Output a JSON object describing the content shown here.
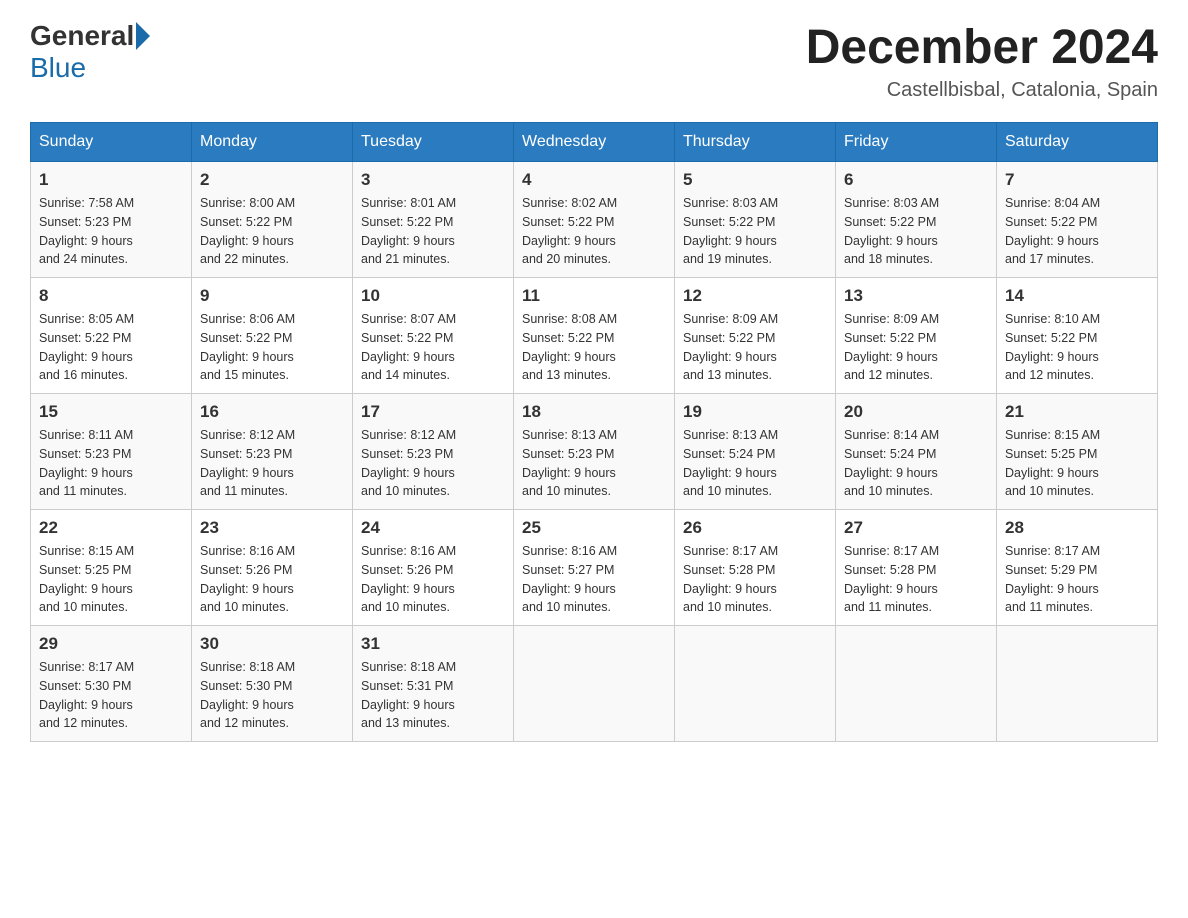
{
  "header": {
    "logo_general": "General",
    "logo_blue": "Blue",
    "month_title": "December 2024",
    "location": "Castellbisbal, Catalonia, Spain"
  },
  "weekdays": [
    "Sunday",
    "Monday",
    "Tuesday",
    "Wednesday",
    "Thursday",
    "Friday",
    "Saturday"
  ],
  "weeks": [
    [
      {
        "day": "1",
        "sunrise": "7:58 AM",
        "sunset": "5:23 PM",
        "daylight": "9 hours and 24 minutes."
      },
      {
        "day": "2",
        "sunrise": "8:00 AM",
        "sunset": "5:22 PM",
        "daylight": "9 hours and 22 minutes."
      },
      {
        "day": "3",
        "sunrise": "8:01 AM",
        "sunset": "5:22 PM",
        "daylight": "9 hours and 21 minutes."
      },
      {
        "day": "4",
        "sunrise": "8:02 AM",
        "sunset": "5:22 PM",
        "daylight": "9 hours and 20 minutes."
      },
      {
        "day": "5",
        "sunrise": "8:03 AM",
        "sunset": "5:22 PM",
        "daylight": "9 hours and 19 minutes."
      },
      {
        "day": "6",
        "sunrise": "8:03 AM",
        "sunset": "5:22 PM",
        "daylight": "9 hours and 18 minutes."
      },
      {
        "day": "7",
        "sunrise": "8:04 AM",
        "sunset": "5:22 PM",
        "daylight": "9 hours and 17 minutes."
      }
    ],
    [
      {
        "day": "8",
        "sunrise": "8:05 AM",
        "sunset": "5:22 PM",
        "daylight": "9 hours and 16 minutes."
      },
      {
        "day": "9",
        "sunrise": "8:06 AM",
        "sunset": "5:22 PM",
        "daylight": "9 hours and 15 minutes."
      },
      {
        "day": "10",
        "sunrise": "8:07 AM",
        "sunset": "5:22 PM",
        "daylight": "9 hours and 14 minutes."
      },
      {
        "day": "11",
        "sunrise": "8:08 AM",
        "sunset": "5:22 PM",
        "daylight": "9 hours and 13 minutes."
      },
      {
        "day": "12",
        "sunrise": "8:09 AM",
        "sunset": "5:22 PM",
        "daylight": "9 hours and 13 minutes."
      },
      {
        "day": "13",
        "sunrise": "8:09 AM",
        "sunset": "5:22 PM",
        "daylight": "9 hours and 12 minutes."
      },
      {
        "day": "14",
        "sunrise": "8:10 AM",
        "sunset": "5:22 PM",
        "daylight": "9 hours and 12 minutes."
      }
    ],
    [
      {
        "day": "15",
        "sunrise": "8:11 AM",
        "sunset": "5:23 PM",
        "daylight": "9 hours and 11 minutes."
      },
      {
        "day": "16",
        "sunrise": "8:12 AM",
        "sunset": "5:23 PM",
        "daylight": "9 hours and 11 minutes."
      },
      {
        "day": "17",
        "sunrise": "8:12 AM",
        "sunset": "5:23 PM",
        "daylight": "9 hours and 10 minutes."
      },
      {
        "day": "18",
        "sunrise": "8:13 AM",
        "sunset": "5:23 PM",
        "daylight": "9 hours and 10 minutes."
      },
      {
        "day": "19",
        "sunrise": "8:13 AM",
        "sunset": "5:24 PM",
        "daylight": "9 hours and 10 minutes."
      },
      {
        "day": "20",
        "sunrise": "8:14 AM",
        "sunset": "5:24 PM",
        "daylight": "9 hours and 10 minutes."
      },
      {
        "day": "21",
        "sunrise": "8:15 AM",
        "sunset": "5:25 PM",
        "daylight": "9 hours and 10 minutes."
      }
    ],
    [
      {
        "day": "22",
        "sunrise": "8:15 AM",
        "sunset": "5:25 PM",
        "daylight": "9 hours and 10 minutes."
      },
      {
        "day": "23",
        "sunrise": "8:16 AM",
        "sunset": "5:26 PM",
        "daylight": "9 hours and 10 minutes."
      },
      {
        "day": "24",
        "sunrise": "8:16 AM",
        "sunset": "5:26 PM",
        "daylight": "9 hours and 10 minutes."
      },
      {
        "day": "25",
        "sunrise": "8:16 AM",
        "sunset": "5:27 PM",
        "daylight": "9 hours and 10 minutes."
      },
      {
        "day": "26",
        "sunrise": "8:17 AM",
        "sunset": "5:28 PM",
        "daylight": "9 hours and 10 minutes."
      },
      {
        "day": "27",
        "sunrise": "8:17 AM",
        "sunset": "5:28 PM",
        "daylight": "9 hours and 11 minutes."
      },
      {
        "day": "28",
        "sunrise": "8:17 AM",
        "sunset": "5:29 PM",
        "daylight": "9 hours and 11 minutes."
      }
    ],
    [
      {
        "day": "29",
        "sunrise": "8:17 AM",
        "sunset": "5:30 PM",
        "daylight": "9 hours and 12 minutes."
      },
      {
        "day": "30",
        "sunrise": "8:18 AM",
        "sunset": "5:30 PM",
        "daylight": "9 hours and 12 minutes."
      },
      {
        "day": "31",
        "sunrise": "8:18 AM",
        "sunset": "5:31 PM",
        "daylight": "9 hours and 13 minutes."
      },
      null,
      null,
      null,
      null
    ]
  ],
  "labels": {
    "sunrise": "Sunrise:",
    "sunset": "Sunset:",
    "daylight": "Daylight:"
  }
}
